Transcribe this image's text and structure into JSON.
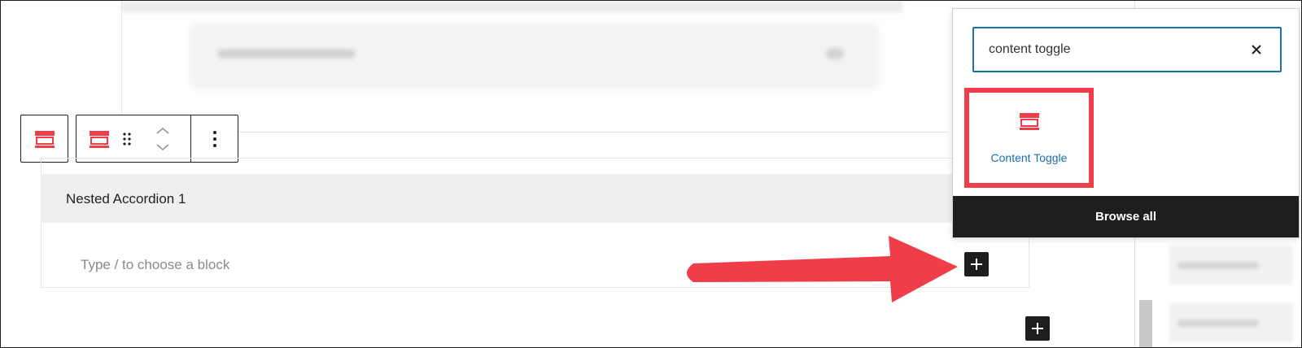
{
  "colors": {
    "accent_red": "#ef3e4a",
    "link_blue": "#1c6fae",
    "focus_blue": "#1a6fb0",
    "dark": "#1e1e1e"
  },
  "toolbar": {
    "block_icon": "content-toggle-icon",
    "drag_icon": "drag-handle-icon",
    "move_icon": "chevron-up-down-icon",
    "options_icon": "more-vertical-icon"
  },
  "accordion": {
    "title": "Nested Accordion 1",
    "placeholder": "Type / to choose a block"
  },
  "inserter": {
    "search_value": "content toggle",
    "clear_icon": "close-icon",
    "results": [
      {
        "label": "Content Toggle",
        "icon": "content-toggle-icon"
      }
    ],
    "browse_all_label": "Browse all"
  },
  "annotation": {
    "arrow_icon": "red-arrow-icon"
  }
}
